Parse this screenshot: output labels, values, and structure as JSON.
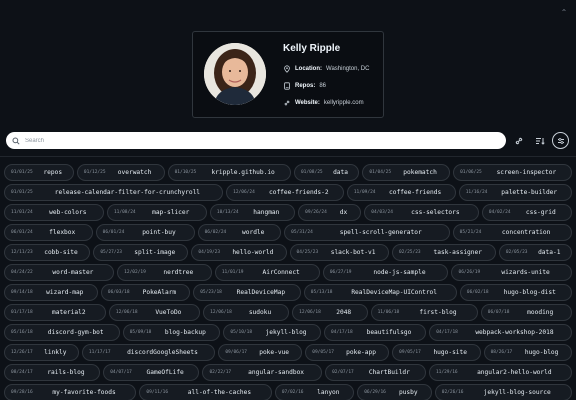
{
  "profile": {
    "name": "Kelly Ripple",
    "location_label": "Location:",
    "location": "Washington, DC",
    "repos_label": "Repos:",
    "repos": "86",
    "website_label": "Website:",
    "website": "kellyripple.com"
  },
  "search": {
    "placeholder": "Search"
  },
  "toolbar": {
    "link_icon": "link-icon",
    "sort_icon": "sort-icon",
    "filter_icon": "filter-icon"
  },
  "repos": [
    [
      {
        "date": "01/01/25",
        "name": "repos"
      },
      {
        "date": "01/12/25",
        "name": "overwatch"
      },
      {
        "date": "01/10/25",
        "name": "kripple.github.io"
      },
      {
        "date": "01/08/25",
        "name": "data"
      },
      {
        "date": "01/04/25",
        "name": "pokematch"
      },
      {
        "date": "01/06/25",
        "name": "screen-inspector"
      }
    ],
    [
      {
        "date": "01/01/25",
        "name": "release-calendar-filter-for-crunchyroll"
      },
      {
        "date": "12/06/24",
        "name": "coffee-friends-2"
      },
      {
        "date": "11/09/24",
        "name": "coffee-friends"
      },
      {
        "date": "11/16/24",
        "name": "palette-builder"
      }
    ],
    [
      {
        "date": "11/01/24",
        "name": "web-colors"
      },
      {
        "date": "11/08/24",
        "name": "map-slicer"
      },
      {
        "date": "10/13/24",
        "name": "hangman"
      },
      {
        "date": "09/26/24",
        "name": "dx"
      },
      {
        "date": "04/03/24",
        "name": "css-selectors"
      },
      {
        "date": "04/02/24",
        "name": "css-grid"
      }
    ],
    [
      {
        "date": "06/01/24",
        "name": "flexbox"
      },
      {
        "date": "06/01/24",
        "name": "point-buy"
      },
      {
        "date": "06/02/24",
        "name": "wordle"
      },
      {
        "date": "05/31/24",
        "name": "spell-scroll-generator"
      },
      {
        "date": "05/21/24",
        "name": "concentration"
      }
    ],
    [
      {
        "date": "12/11/23",
        "name": "cobb-site"
      },
      {
        "date": "05/27/23",
        "name": "split-image"
      },
      {
        "date": "04/19/23",
        "name": "hello-world"
      },
      {
        "date": "04/25/23",
        "name": "slack-bot-v1"
      },
      {
        "date": "02/25/23",
        "name": "task-assigner"
      },
      {
        "date": "02/05/23",
        "name": "data-1"
      }
    ],
    [
      {
        "date": "04/24/22",
        "name": "word-master"
      },
      {
        "date": "12/02/19",
        "name": "nerdtree"
      },
      {
        "date": "11/01/19",
        "name": "AirConnect"
      },
      {
        "date": "06/27/19",
        "name": "node-js-sample"
      },
      {
        "date": "06/26/19",
        "name": "wizards-unite"
      }
    ],
    [
      {
        "date": "09/14/18",
        "name": "wizard-map"
      },
      {
        "date": "06/03/18",
        "name": "PokeAlarm"
      },
      {
        "date": "05/23/18",
        "name": "RealDeviceMap"
      },
      {
        "date": "05/13/18",
        "name": "RealDeviceMap-UIControl"
      },
      {
        "date": "06/02/18",
        "name": "hugo-blog-dist"
      }
    ],
    [
      {
        "date": "01/17/18",
        "name": "material2"
      },
      {
        "date": "12/06/18",
        "name": "VueToDo"
      },
      {
        "date": "12/06/18",
        "name": "sudoku"
      },
      {
        "date": "12/06/18",
        "name": "2048"
      },
      {
        "date": "11/06/18",
        "name": "first-blog"
      },
      {
        "date": "06/07/18",
        "name": "mooding"
      }
    ],
    [
      {
        "date": "05/16/18",
        "name": "discord-gym-bot"
      },
      {
        "date": "05/09/18",
        "name": "blog-backup"
      },
      {
        "date": "05/10/18",
        "name": "jekyll-blog"
      },
      {
        "date": "04/17/18",
        "name": "beautifulsgo"
      },
      {
        "date": "04/17/18",
        "name": "webpack-workshop-2018"
      }
    ],
    [
      {
        "date": "12/26/17",
        "name": "linkly"
      },
      {
        "date": "11/17/17",
        "name": "discordGoogleSheets"
      },
      {
        "date": "09/06/17",
        "name": "poke-vue"
      },
      {
        "date": "09/05/17",
        "name": "poke-app"
      },
      {
        "date": "09/05/17",
        "name": "hugo-site"
      },
      {
        "date": "08/26/17",
        "name": "hugo-blog"
      }
    ],
    [
      {
        "date": "08/24/17",
        "name": "rails-blog"
      },
      {
        "date": "04/07/17",
        "name": "GameOfLife"
      },
      {
        "date": "02/22/17",
        "name": "angular-sandbox"
      },
      {
        "date": "02/07/17",
        "name": "ChartBuildr"
      },
      {
        "date": "11/29/16",
        "name": "angular2-hello-world"
      }
    ],
    [
      {
        "date": "09/28/16",
        "name": "my-favorite-foods"
      },
      {
        "date": "09/11/16",
        "name": "all-of-the-caches"
      },
      {
        "date": "07/02/16",
        "name": "lanyon"
      },
      {
        "date": "06/29/16",
        "name": "pusby"
      },
      {
        "date": "02/26/16",
        "name": "jekyll-blog-source"
      }
    ]
  ]
}
